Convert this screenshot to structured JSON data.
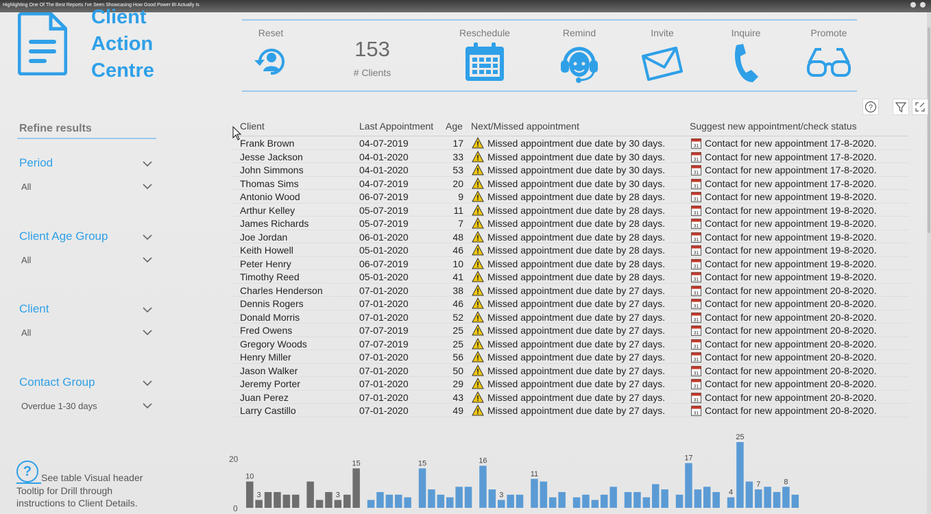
{
  "window": {
    "title": "Highlighting One Of The Best Reports I've Seen Showcasing How Good Power BI Actually Is"
  },
  "logo": {
    "icon": "document-icon",
    "title_lines": [
      "Client",
      "Action",
      "Centre"
    ]
  },
  "actions": [
    {
      "label": "Reset",
      "icon": "reset-person-icon"
    },
    {
      "label": "Reschedule",
      "icon": "calendar-icon"
    },
    {
      "label": "Remind",
      "icon": "headset-icon"
    },
    {
      "label": "Invite",
      "icon": "envelope-icon"
    },
    {
      "label": "Inquire",
      "icon": "phone-icon"
    },
    {
      "label": "Promote",
      "icon": "glasses-icon"
    }
  ],
  "kpi": {
    "value": "153",
    "label": "# Clients"
  },
  "visual_header": [
    "help-icon",
    "filter-icon",
    "focus-mode-icon"
  ],
  "sidebar": {
    "title": "Refine results",
    "slicers": [
      {
        "label": "Period",
        "value": "All"
      },
      {
        "label": "Client Age Group",
        "value": "All"
      },
      {
        "label": "Client",
        "value": "All"
      },
      {
        "label": "Contact Group",
        "value": "Overdue 1-30 days"
      }
    ],
    "help": {
      "symbol": "?",
      "text": "See table Visual header Tooltip for Drill through instructions to Client Details."
    }
  },
  "table": {
    "columns": [
      "Client",
      "Last Appointment",
      "Age",
      "Next/Missed appointment",
      "Suggest new appointment/check status"
    ],
    "rows": [
      [
        "Frank Brown",
        "04-07-2019",
        "17",
        "Missed appointment due date by 30 days.",
        "Contact for new appointment 17-8-2020."
      ],
      [
        "Jesse Jackson",
        "04-01-2020",
        "33",
        "Missed appointment due date by 30 days.",
        "Contact for new appointment 17-8-2020."
      ],
      [
        "John Simmons",
        "04-01-2020",
        "53",
        "Missed appointment due date by 30 days.",
        "Contact for new appointment 17-8-2020."
      ],
      [
        "Thomas Sims",
        "04-07-2019",
        "20",
        "Missed appointment due date by 30 days.",
        "Contact for new appointment 17-8-2020."
      ],
      [
        "Antonio Wood",
        "06-07-2019",
        "9",
        "Missed appointment due date by 28 days.",
        "Contact for new appointment 19-8-2020."
      ],
      [
        "Arthur Kelley",
        "05-07-2019",
        "11",
        "Missed appointment due date by 28 days.",
        "Contact for new appointment 19-8-2020."
      ],
      [
        "James Richards",
        "05-07-2019",
        "7",
        "Missed appointment due date by 28 days.",
        "Contact for new appointment 19-8-2020."
      ],
      [
        "Joe Jordan",
        "06-01-2020",
        "48",
        "Missed appointment due date by 28 days.",
        "Contact for new appointment 19-8-2020."
      ],
      [
        "Keith Howell",
        "05-01-2020",
        "46",
        "Missed appointment due date by 28 days.",
        "Contact for new appointment 19-8-2020."
      ],
      [
        "Peter Henry",
        "06-07-2019",
        "10",
        "Missed appointment due date by 28 days.",
        "Contact for new appointment 19-8-2020."
      ],
      [
        "Timothy Reed",
        "05-01-2020",
        "41",
        "Missed appointment due date by 28 days.",
        "Contact for new appointment 19-8-2020."
      ],
      [
        "Charles Henderson",
        "07-01-2020",
        "38",
        "Missed appointment due date by 27 days.",
        "Contact for new appointment 20-8-2020."
      ],
      [
        "Dennis Rogers",
        "07-01-2020",
        "46",
        "Missed appointment due date by 27 days.",
        "Contact for new appointment 20-8-2020."
      ],
      [
        "Donald Morris",
        "07-01-2020",
        "52",
        "Missed appointment due date by 27 days.",
        "Contact for new appointment 20-8-2020."
      ],
      [
        "Fred Owens",
        "07-07-2019",
        "25",
        "Missed appointment due date by 27 days.",
        "Contact for new appointment 20-8-2020."
      ],
      [
        "Gregory Woods",
        "07-07-2019",
        "25",
        "Missed appointment due date by 27 days.",
        "Contact for new appointment 20-8-2020."
      ],
      [
        "Henry Miller",
        "07-01-2020",
        "56",
        "Missed appointment due date by 27 days.",
        "Contact for new appointment 20-8-2020."
      ],
      [
        "Jason Walker",
        "07-01-2020",
        "50",
        "Missed appointment due date by 27 days.",
        "Contact for new appointment 20-8-2020."
      ],
      [
        "Jeremy Porter",
        "07-01-2020",
        "29",
        "Missed appointment due date by 27 days.",
        "Contact for new appointment 20-8-2020."
      ],
      [
        "Juan Perez",
        "07-01-2020",
        "43",
        "Missed appointment due date by 27 days.",
        "Contact for new appointment 20-8-2020."
      ],
      [
        "Larry Castillo",
        "07-01-2020",
        "49",
        "Missed appointment due date by 27 days.",
        "Contact for new appointment 20-8-2020."
      ]
    ],
    "row_icons": {
      "status": "warning-icon",
      "suggest": "calendar-31-icon"
    }
  },
  "colors": {
    "accent": "#2fa0e8",
    "bar_blue": "#5b9bd5",
    "bar_gray": "#6e6e6e",
    "warning": "#f2c811"
  },
  "chart_data": {
    "type": "bar",
    "ylim": [
      0,
      25
    ],
    "yticks": [
      "0",
      "20"
    ],
    "series": [
      {
        "values": [
          10,
          3,
          6,
          6,
          5,
          5,
          10,
          3,
          6,
          3,
          5,
          15,
          3,
          6,
          5,
          5,
          4,
          15,
          7,
          5,
          4,
          8,
          8,
          16,
          7,
          3,
          5,
          5,
          11,
          10,
          4,
          6,
          4,
          5,
          3,
          5,
          8,
          6,
          6,
          4,
          9,
          7,
          5,
          17,
          7,
          8,
          6,
          4,
          25,
          10,
          7,
          8,
          6,
          8,
          5
        ],
        "colors": [
          "gray",
          "gray",
          "gray",
          "gray",
          "gray",
          "gray",
          "gray",
          "gray",
          "gray",
          "gray",
          "gray",
          "gray",
          "blue",
          "blue",
          "blue",
          "blue",
          "blue",
          "blue",
          "blue",
          "blue",
          "blue",
          "blue",
          "blue",
          "blue",
          "blue",
          "blue",
          "blue",
          "blue",
          "blue",
          "blue",
          "blue",
          "blue",
          "blue",
          "blue",
          "blue",
          "blue",
          "blue",
          "blue",
          "blue",
          "blue",
          "blue",
          "blue",
          "blue",
          "blue",
          "blue",
          "blue",
          "blue",
          "blue",
          "blue",
          "blue",
          "blue",
          "blue",
          "blue",
          "blue",
          "blue"
        ],
        "labels": [
          {
            "index": 0,
            "text": "10"
          },
          {
            "index": 1,
            "text": "3"
          },
          {
            "index": 9,
            "text": "3"
          },
          {
            "index": 11,
            "text": "15"
          },
          {
            "index": 17,
            "text": "15"
          },
          {
            "index": 23,
            "text": "16"
          },
          {
            "index": 25,
            "text": "3"
          },
          {
            "index": 28,
            "text": "11"
          },
          {
            "index": 43,
            "text": "17"
          },
          {
            "index": 47,
            "text": "4"
          },
          {
            "index": 48,
            "text": "25"
          },
          {
            "index": 50,
            "text": "7"
          },
          {
            "index": 53,
            "text": "8"
          }
        ]
      }
    ]
  }
}
